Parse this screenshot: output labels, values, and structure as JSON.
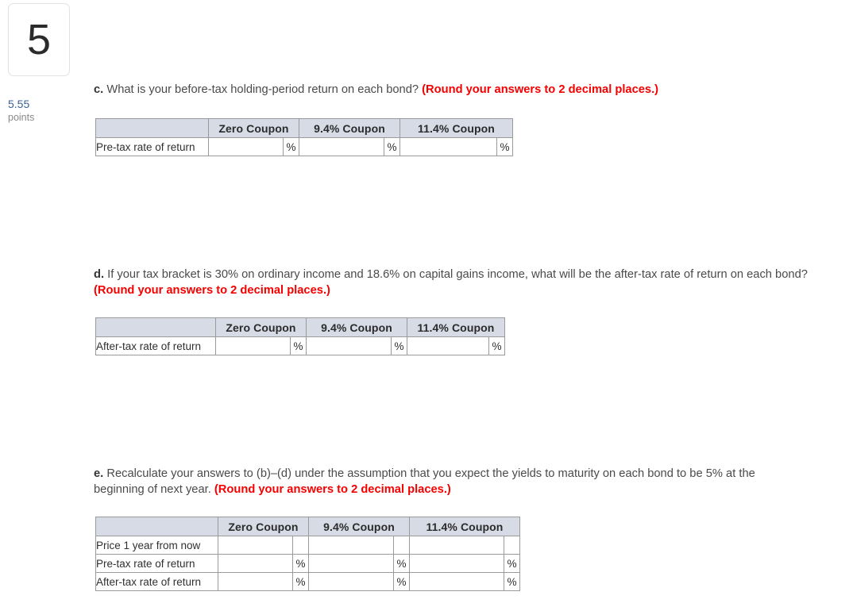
{
  "question_rail": {
    "number": "5",
    "points_value": "5.55",
    "points_label": "points"
  },
  "accent_colors": {
    "round_note_red": "#f60000",
    "points_blue": "#3c6093",
    "table_header_bg": "#d6dbe6",
    "table_border": "#9a9a9a"
  },
  "parts": [
    {
      "letter": "c.",
      "prompt": "What is your before-tax holding-period return on each bond?",
      "round_note": "(Round your answers to 2 decimal places.)",
      "table": {
        "corner_header": "",
        "headers": [
          "Zero Coupon",
          "9.4% Coupon",
          "11.4% Coupon"
        ],
        "rows": [
          {
            "label": "Pre-tax rate of return",
            "values": [
              "",
              "",
              ""
            ],
            "suffixes": [
              "%",
              "%",
              "%"
            ]
          }
        ]
      }
    },
    {
      "letter": "d.",
      "prompt": "If your tax bracket is 30% on ordinary income and 18.6% on capital gains income, what will be the after-tax rate of return on each bond?",
      "round_note": "(Round your answers to 2 decimal places.)",
      "table": {
        "corner_header": "",
        "headers": [
          "Zero Coupon",
          "9.4% Coupon",
          "11.4% Coupon"
        ],
        "rows": [
          {
            "label": "After-tax rate of return",
            "values": [
              "",
              "",
              ""
            ],
            "suffixes": [
              "%",
              "%",
              "%"
            ]
          }
        ]
      }
    },
    {
      "letter": "e.",
      "prompt": "Recalculate your answers to (b)–(d) under the assumption that you expect the yields to maturity on each bond to be 5% at the beginning of next year.",
      "round_note": "(Round your answers to 2 decimal places.)",
      "table": {
        "corner_header": "",
        "headers": [
          "Zero Coupon",
          "9.4% Coupon",
          "11.4% Coupon"
        ],
        "rows": [
          {
            "label": "Price 1 year from now",
            "values": [
              "",
              "",
              ""
            ],
            "suffixes": [
              "",
              "",
              ""
            ]
          },
          {
            "label": "Pre-tax rate of return",
            "values": [
              "",
              "",
              ""
            ],
            "suffixes": [
              "%",
              "%",
              "%"
            ]
          },
          {
            "label": "After-tax rate of return",
            "values": [
              "",
              "",
              ""
            ],
            "suffixes": [
              "%",
              "%",
              "%"
            ]
          }
        ]
      }
    }
  ]
}
